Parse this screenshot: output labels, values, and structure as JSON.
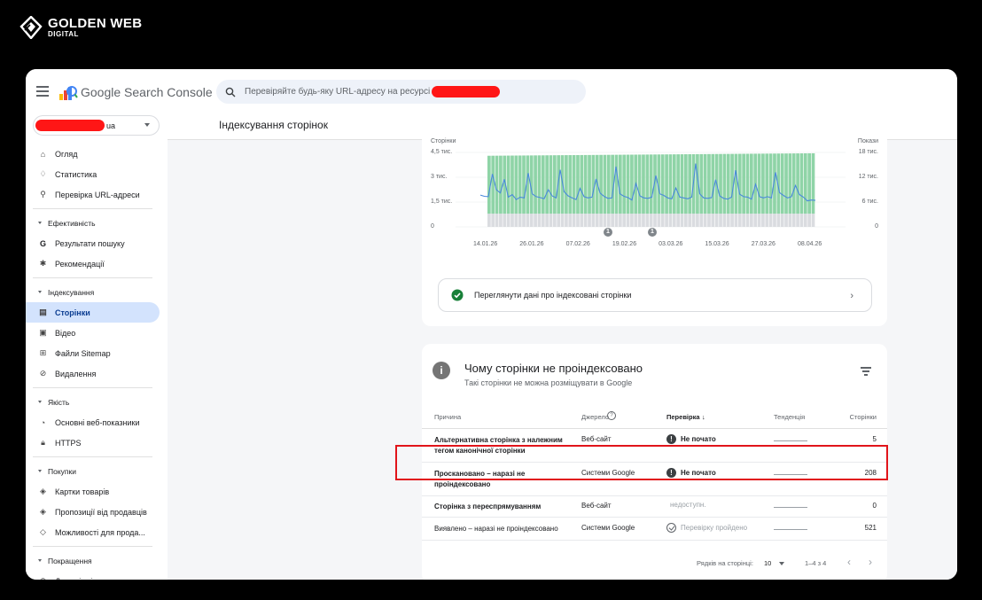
{
  "brand": {
    "name": "GOLDEN WEB",
    "sub": "DIGITAL"
  },
  "app": {
    "title": "Google Search Console"
  },
  "search": {
    "placeholder": "Перевіряйте будь-яку URL-адресу на ресурсі"
  },
  "property": {
    "suffix": "ua"
  },
  "page": {
    "title": "Індексування сторінок"
  },
  "sidebar": {
    "items": [
      {
        "type": "item",
        "label": "Огляд",
        "icon": "home-icon",
        "glyph": "⌂"
      },
      {
        "type": "item",
        "label": "Статистика",
        "icon": "lightbulb-icon",
        "glyph": "♢"
      },
      {
        "type": "item",
        "label": "Перевірка URL-адреси",
        "icon": "search-icon",
        "glyph": "⚲"
      },
      {
        "type": "divider"
      },
      {
        "type": "section",
        "label": "Ефективність"
      },
      {
        "type": "item",
        "label": "Результати пошуку",
        "icon": "google-g-icon",
        "glyph": "G"
      },
      {
        "type": "item",
        "label": "Рекомендації",
        "icon": "sparkle-icon",
        "glyph": "✱"
      },
      {
        "type": "divider"
      },
      {
        "type": "section",
        "label": "Індексування"
      },
      {
        "type": "item",
        "label": "Сторінки",
        "icon": "pages-icon",
        "glyph": "▤",
        "active": true
      },
      {
        "type": "item",
        "label": "Відео",
        "icon": "video-icon",
        "glyph": "▣"
      },
      {
        "type": "item",
        "label": "Файли Sitemap",
        "icon": "sitemap-icon",
        "glyph": "⊞"
      },
      {
        "type": "item",
        "label": "Видалення",
        "icon": "removal-icon",
        "glyph": "⊘"
      },
      {
        "type": "divider"
      },
      {
        "type": "section",
        "label": "Якість"
      },
      {
        "type": "item",
        "label": "Основні веб-показники",
        "icon": "gauge-icon",
        "glyph": "◔"
      },
      {
        "type": "item",
        "label": "HTTPS",
        "icon": "lock-icon",
        "glyph": "🔒︎"
      },
      {
        "type": "divider"
      },
      {
        "type": "section",
        "label": "Покупки"
      },
      {
        "type": "item",
        "label": "Картки товарів",
        "icon": "layers-icon",
        "glyph": "◈"
      },
      {
        "type": "item",
        "label": "Пропозиції від продавців",
        "icon": "layers-icon",
        "glyph": "◈"
      },
      {
        "type": "item",
        "label": "Можливості для прода...",
        "icon": "tag-icon",
        "glyph": "◇"
      },
      {
        "type": "divider"
      },
      {
        "type": "section",
        "label": "Покращення"
      },
      {
        "type": "item",
        "label": "Допоміжні посилання",
        "icon": "link-icon",
        "glyph": "⊕"
      }
    ]
  },
  "chart_data": {
    "type": "bar",
    "title": "",
    "ylabel": "Сторінки",
    "y2label": "Покази",
    "y_ticks": [
      "0",
      "1,5 тис.",
      "3 тис.",
      "4,5 тис."
    ],
    "y2_ticks": [
      "0",
      "6 тис.",
      "12 тис.",
      "18 тис."
    ],
    "ylim": [
      0,
      4500
    ],
    "y2lim": [
      0,
      18000
    ],
    "x_ticks": [
      "14.01.26",
      "26.01.26",
      "07.02.26",
      "19.02.26",
      "03.03.26",
      "15.03.26",
      "27.03.26",
      "08.04.26"
    ],
    "bars": {
      "count": 85,
      "segments": [
        {
          "name": "not-indexed",
          "color": "#dadce0",
          "value": 800
        },
        {
          "name": "indexed",
          "color": "#8fd4a7",
          "value_start": 3500,
          "value_end": 3650
        }
      ]
    },
    "annotations": [
      "1",
      "1"
    ],
    "series": [
      {
        "axis": "right",
        "color": "#4a89dc",
        "values": [
          7700,
          7400,
          7300,
          12800,
          9000,
          8200,
          11500,
          7200,
          7800,
          6600,
          7200,
          7000,
          13000,
          8000,
          7300,
          7100,
          6800,
          9000,
          7500,
          7000,
          13800,
          8500,
          7500,
          7000,
          6600,
          9300,
          7300,
          7000,
          7200,
          11600,
          8200,
          7400,
          6900,
          7000,
          14600,
          8000,
          7400,
          7100,
          6500,
          10500,
          7500,
          7000,
          6900,
          7200,
          12400,
          8000,
          7600,
          7000,
          6800,
          9400,
          7200,
          7000,
          6800,
          7200,
          15300,
          8000,
          7000,
          6900,
          7100,
          11400,
          7500,
          6900,
          6700,
          7200,
          13700,
          7900,
          7300,
          7200,
          6700,
          10300,
          7300,
          7000,
          7300,
          7000,
          13200,
          8300,
          7600,
          7000,
          7300,
          10000,
          7800,
          7200,
          6300,
          6500,
          6400
        ]
      }
    ]
  },
  "view_link": {
    "label": "Переглянути дані про індексовані сторінки"
  },
  "not_indexed": {
    "title": "Чому сторінки не проіндексовано",
    "subtitle": "Такі сторінки не можна розміщувати в Google",
    "headers": {
      "reason": "Причина",
      "source": "Джерело",
      "check": "Перевірка",
      "trend": "Тенденція",
      "pages": "Сторінки"
    },
    "rows": [
      {
        "reason": "Альтернативна сторінка з належним тегом канонічної сторінки",
        "source": "Веб-сайт",
        "check": "Не почато",
        "status": "warn",
        "pages": "5"
      },
      {
        "reason": "Проскановано – наразі не проіндексовано",
        "source": "Системи Google",
        "check": "Не почато",
        "status": "warn",
        "pages": "208"
      },
      {
        "reason": "Сторінка з переспрямуванням",
        "source": "Веб-сайт",
        "check": "недоступн.",
        "status": "na",
        "pages": "0"
      },
      {
        "reason": "Виявлено – наразі не проіндексовано",
        "source": "Системи Google",
        "check": "Перевірку пройдено",
        "status": "ok",
        "pages": "521"
      }
    ],
    "pagination": {
      "rows_label": "Рядків на сторінці:",
      "rows_value": "10",
      "range": "1–4 з 4"
    }
  }
}
